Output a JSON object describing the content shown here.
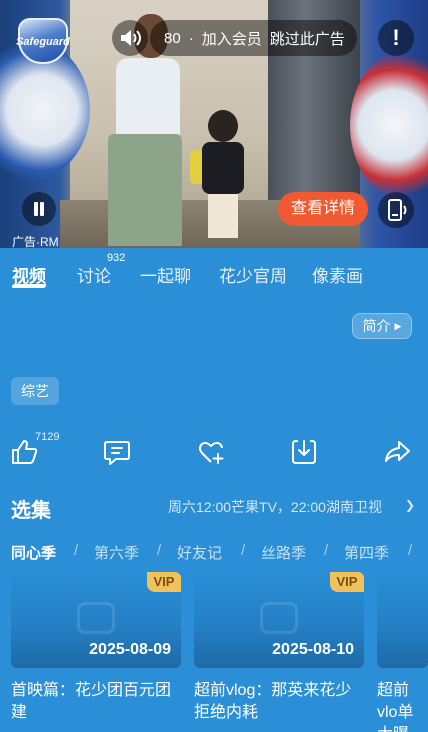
{
  "ad": {
    "brand": "Safeguard",
    "countdown": "80",
    "separator": "·",
    "join_vip": "加入会员",
    "skip_ad": "跳过此广告",
    "warning_mark": "!",
    "view_details": "查看详情",
    "ad_label": "广告·RM"
  },
  "tabs": {
    "items": [
      {
        "label": "视频"
      },
      {
        "label": "讨论"
      },
      {
        "label": "一起聊"
      },
      {
        "label": "花少官周"
      },
      {
        "label": "像素画"
      }
    ],
    "discussion_badge": "932"
  },
  "intro": {
    "label": "简介",
    "arrow": "▶"
  },
  "genre_tag": "综艺",
  "actions": {
    "like_count": "7129",
    "icons": [
      "thumbs-up-icon",
      "comment-icon",
      "heart-plus-icon",
      "download-icon",
      "share-icon"
    ]
  },
  "episodes": {
    "title": "选集",
    "schedule": "周六12:00芒果TV，22:00湖南卫视",
    "schedule_arrow": "❯",
    "seasons": [
      {
        "label": "同心季"
      },
      {
        "label": "第六季"
      },
      {
        "label": "好友记"
      },
      {
        "label": "丝路季"
      },
      {
        "label": "第四季"
      }
    ],
    "season_separator": "/",
    "cards": [
      {
        "vip": "VIP",
        "date": "2025-08-09",
        "caption": "首映篇：花少团百元团建"
      },
      {
        "vip": "VIP",
        "date": "2025-08-10",
        "caption": "超前vlog：那英来花少拒绝内耗"
      },
      {
        "vip": "",
        "date": "",
        "caption": "超前vlo单大曝"
      }
    ]
  },
  "colors": {
    "background": "#2a8fd6",
    "detail_button": "#ef5a32",
    "vip_badge": "#f2c25a"
  }
}
